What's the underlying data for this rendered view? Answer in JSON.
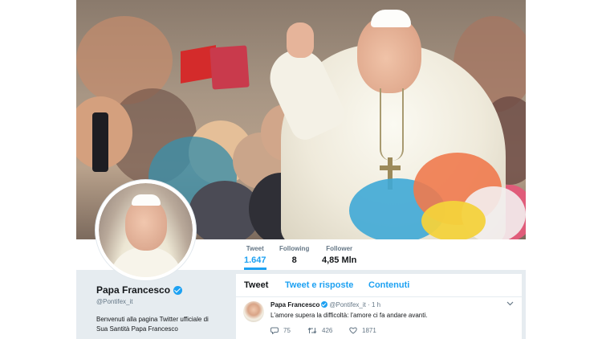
{
  "profile": {
    "name": "Papa Francesco",
    "handle": "@Pontifex_it",
    "bio_line1": "Benvenuti alla pagina Twitter ufficiale di",
    "bio_line2": "Sua Santità Papa Francesco"
  },
  "stats": [
    {
      "label": "Tweet",
      "value": "1.647",
      "active": true
    },
    {
      "label": "Following",
      "value": "8",
      "active": false
    },
    {
      "label": "Follower",
      "value": "4,85 Mln",
      "active": false
    }
  ],
  "timeline_tabs": [
    {
      "label": "Tweet",
      "active": true
    },
    {
      "label": "Tweet e risposte",
      "active": false
    },
    {
      "label": "Contenuti",
      "active": false
    }
  ],
  "tweet": {
    "author": "Papa Francesco",
    "handle": "@Pontifex_it",
    "separator": "·",
    "time": "1 h",
    "text": "L'amore supera la difficoltà: l'amore ci fa andare avanti.",
    "replies": "75",
    "retweets": "426",
    "likes": "1871"
  },
  "icons": {
    "verified": "verified-badge-icon",
    "reply": "reply-icon",
    "retweet": "retweet-icon",
    "like": "heart-icon",
    "more": "chevron-down-icon"
  },
  "colors": {
    "accent": "#1da1f2",
    "background_gray": "#e6ecf0",
    "text_primary": "#14171a",
    "text_secondary": "#657786"
  }
}
